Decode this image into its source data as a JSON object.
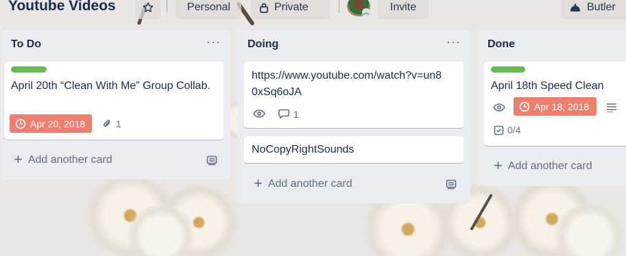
{
  "board": {
    "title": "Youtube Videos",
    "visibility_team": "Personal",
    "visibility_privacy": "Private",
    "invite_label": "Invite",
    "butler_label": "Butler"
  },
  "lists": [
    {
      "title": "To Do",
      "cards": [
        {
          "title": "April 20th “Clean With Me” Group Collab.",
          "due": "Apr 20, 2018",
          "attachments": "1"
        }
      ],
      "add_card": "Add another card"
    },
    {
      "title": "Doing",
      "cards": [
        {
          "title": "https://www.youtube.com/watch?v=un80xSq6oJA",
          "comments": "1"
        },
        {
          "title": "NoCopyRightSounds"
        }
      ],
      "add_card": "Add another card"
    },
    {
      "title": "Done",
      "cards": [
        {
          "title": "April 18th Speed Clean",
          "due": "Apr 18, 2018",
          "checklist": "0/4"
        }
      ],
      "add_card": "Add another card"
    }
  ],
  "icons": {
    "star": "star-icon",
    "lock": "lock-icon",
    "butler": "bell-icon",
    "clock": "clock-icon",
    "paperclip": "paperclip-icon",
    "eye": "eye-icon",
    "comment": "comment-icon",
    "description": "description-icon",
    "checklist": "checklist-icon",
    "template": "card-template-icon",
    "more": "more-icon"
  },
  "colors": {
    "label_green": "#61bd4f",
    "due_red": "#eb5a46",
    "list_bg": "#ebecf0"
  }
}
